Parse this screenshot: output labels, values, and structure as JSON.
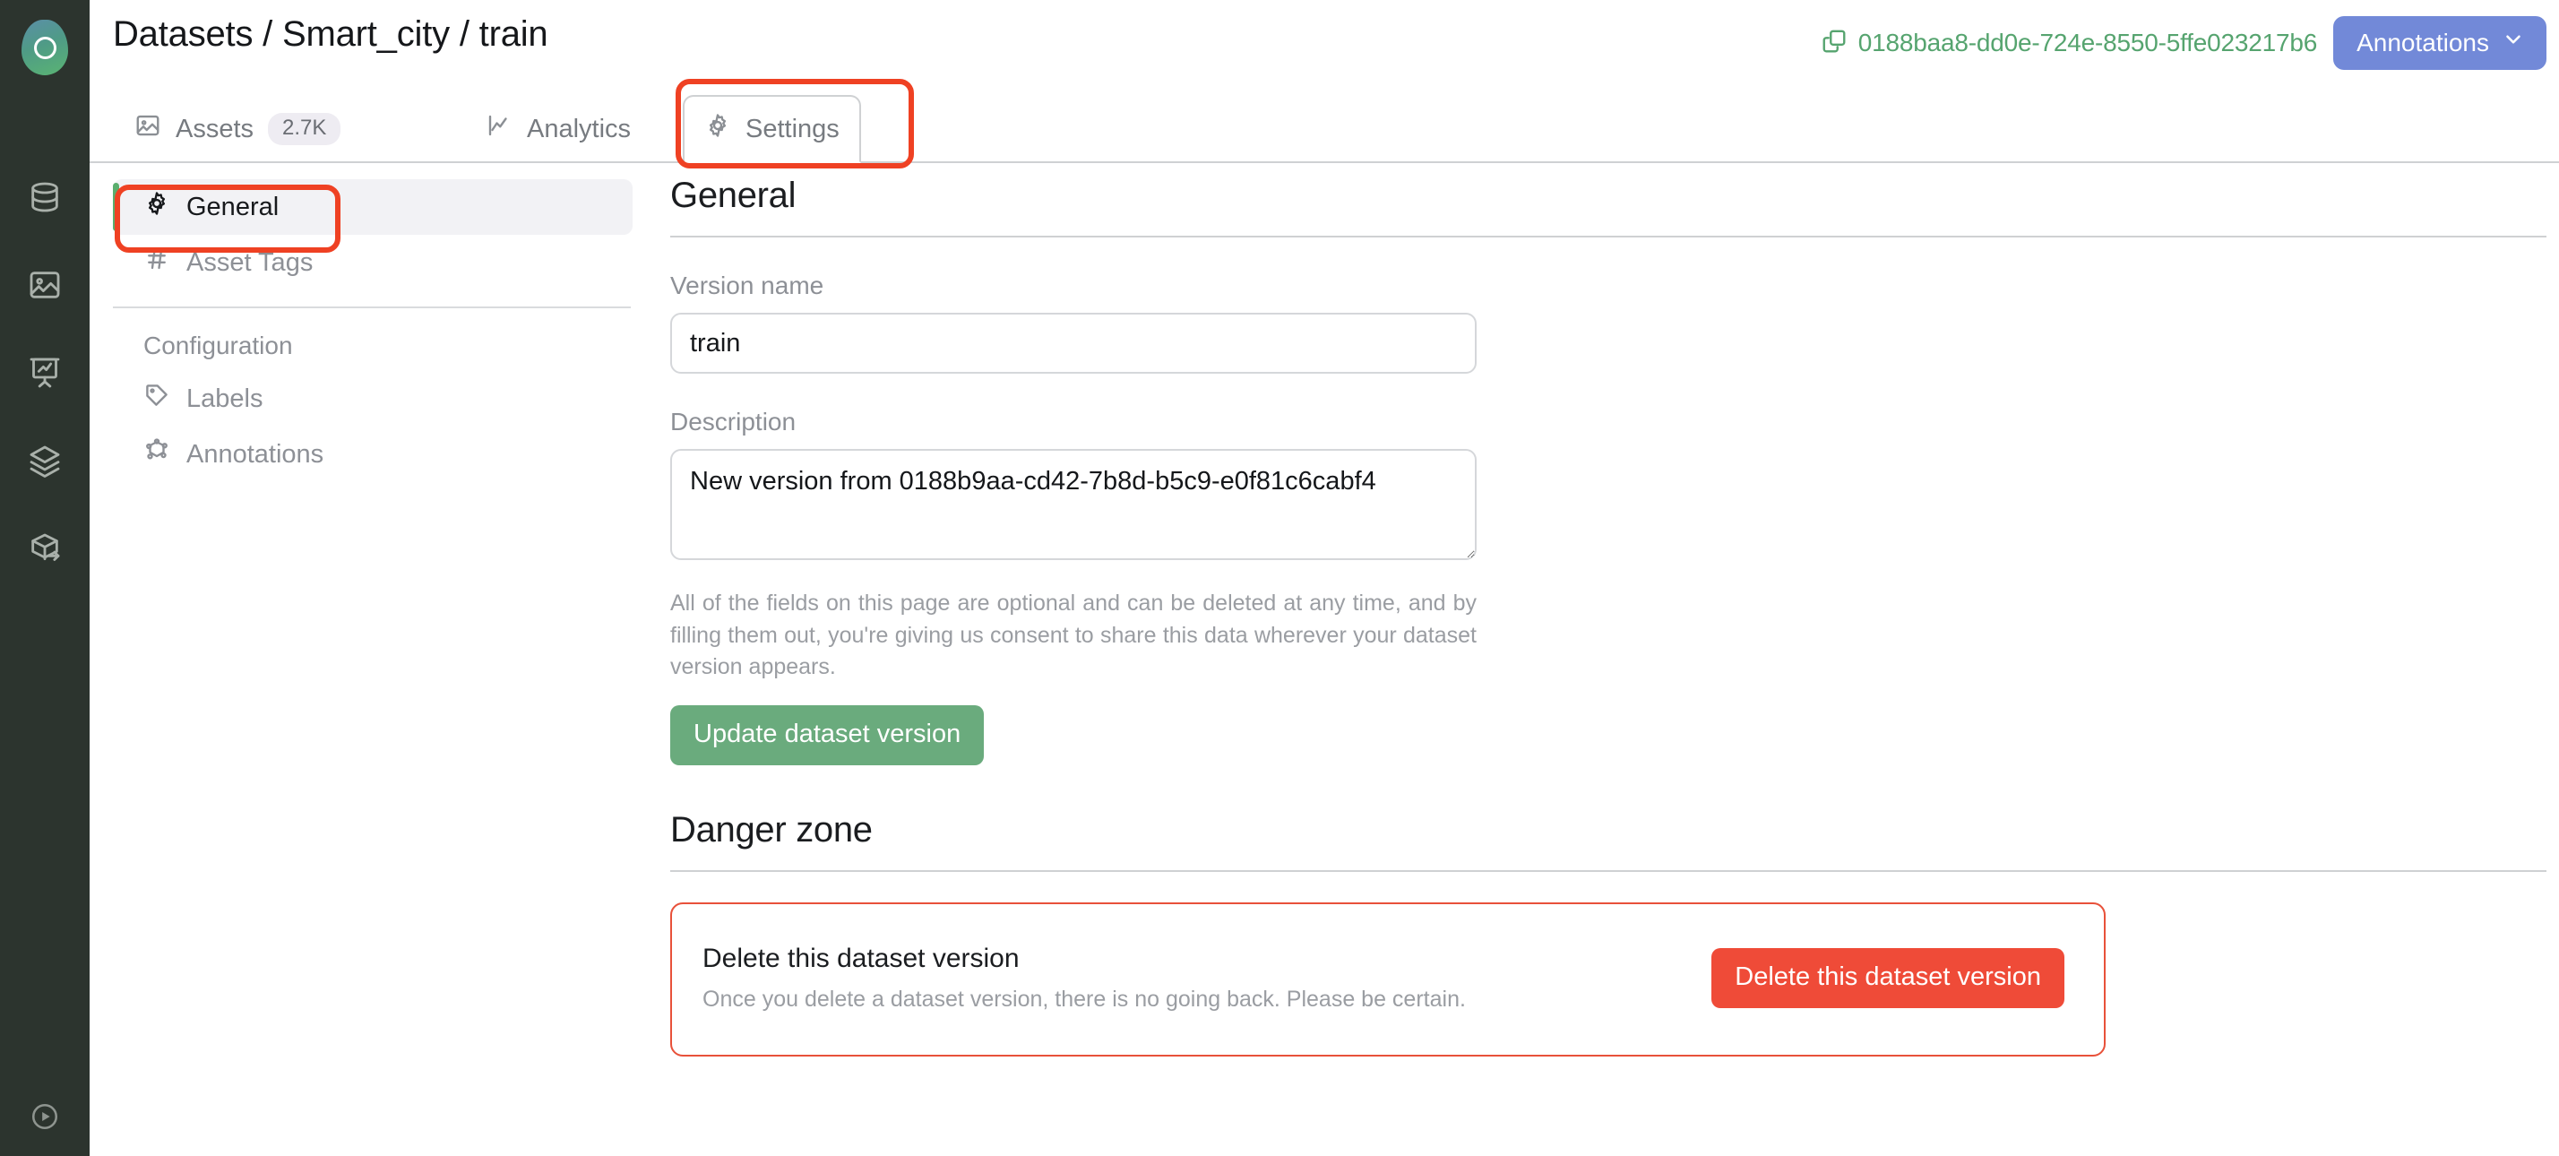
{
  "header": {
    "title": "Datasets / Smart_city / train",
    "uuid": "0188baa8-dd0e-724e-8550-5ffe023217b6",
    "copy_icon": "copy-icon",
    "annotations_button": "Annotations",
    "annotations_chevron": "chevron-down-icon",
    "accent_blue": "#7289d8",
    "accent_green": "#56a46f"
  },
  "rail": {
    "logo": "app-logo",
    "items": [
      {
        "icon": "database-icon",
        "name": "datasets"
      },
      {
        "icon": "image-icon",
        "name": "images"
      },
      {
        "icon": "presentation-chart-icon",
        "name": "analytics"
      },
      {
        "icon": "layers-icon",
        "name": "models"
      },
      {
        "icon": "package-export-icon",
        "name": "deployments"
      }
    ],
    "bottom": {
      "icon": "play-circle-icon",
      "name": "run"
    }
  },
  "tabs": [
    {
      "label": "Assets",
      "icon": "image-icon",
      "count": "2.7K",
      "active": false
    },
    {
      "label": "Analytics",
      "icon": "line-chart-icon",
      "count": "",
      "active": false
    },
    {
      "label": "Settings",
      "icon": "gear-icon",
      "count": "",
      "active": true
    }
  ],
  "sidebar": {
    "items": [
      {
        "label": "General",
        "icon": "gear-icon",
        "active": true
      },
      {
        "label": "Asset Tags",
        "icon": "hash-icon",
        "active": false
      }
    ],
    "section_label": "Configuration",
    "config_items": [
      {
        "label": "Labels",
        "icon": "tag-icon",
        "active": false
      },
      {
        "label": "Annotations",
        "icon": "annotation-nodes-icon",
        "active": false
      }
    ]
  },
  "main": {
    "section_title": "General",
    "version_name_label": "Version name",
    "version_name_value": "train",
    "version_name_placeholder": "Version name",
    "description_label": "Description",
    "description_value": "New version from 0188b9aa-cd42-7b8d-b5c9-e0f81c6cabf4",
    "description_placeholder": "Description",
    "help_text": "All of the fields on this page are optional and can be deleted at any time, and by filling them out, you're giving us consent to share this data wherever your dataset version appears.",
    "update_button": "Update dataset version",
    "danger_title": "Danger zone",
    "danger_item_title": "Delete this dataset version",
    "danger_item_sub": "Once you delete a dataset version, there is no going back. Please be certain.",
    "danger_button": "Delete this dataset version",
    "danger_color": "#ef4b38",
    "primary_color": "#6aab7d"
  },
  "annotations_overlay": [
    {
      "name": "settings-tab-highlight"
    },
    {
      "name": "general-sidebar-highlight"
    }
  ]
}
